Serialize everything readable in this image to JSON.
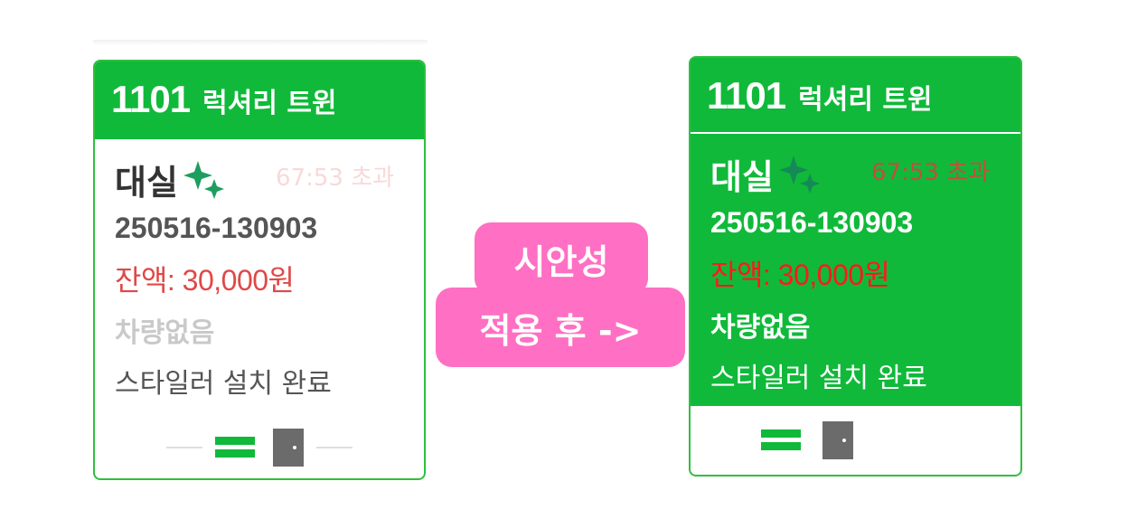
{
  "before_card": {
    "room_number": "1101",
    "room_type": "럭셔리 트윈",
    "status": "대실",
    "timer": "67:53 초과",
    "contract_id": "250516-130903",
    "balance": "잔액: 30,000원",
    "vehicle": "차량없음",
    "note": "스타일러 설치 완료"
  },
  "label": {
    "line1": "시안성",
    "line2": "적용 후 ->"
  },
  "after_card": {
    "room_number": "1101",
    "room_type": "럭셔리 트윈",
    "status": "대실",
    "timer": "67:53 초과",
    "contract_id": "250516-130903",
    "balance": "잔액: 30,000원",
    "vehicle": "차량없음",
    "note": "스타일러 설치 완료"
  },
  "colors": {
    "card_green": "#10b93a",
    "label_pink": "#ff6fc3",
    "balance_red": "#e04848",
    "sparkle_before": "#1e9e5e",
    "sparkle_after": "#158a57"
  },
  "icons": [
    "sparkle-icon",
    "card-icon",
    "door-icon"
  ]
}
